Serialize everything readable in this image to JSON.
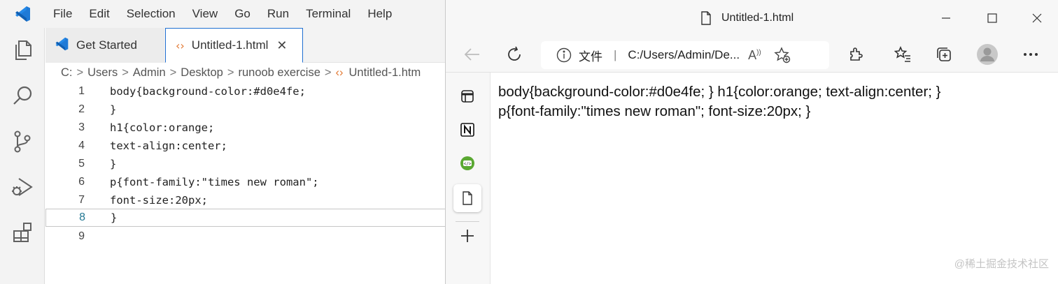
{
  "vscode": {
    "menu": [
      "File",
      "Edit",
      "Selection",
      "View",
      "Go",
      "Run",
      "Terminal",
      "Help"
    ],
    "activity_icons": [
      "explorer-icon",
      "search-icon",
      "source-control-icon",
      "run-debug-icon",
      "extensions-icon"
    ],
    "tabs": [
      {
        "label": "Get Started",
        "active": false
      },
      {
        "label": "Untitled-1.html",
        "active": true
      }
    ],
    "breadcrumb": [
      "C:",
      "Users",
      "Admin",
      "Desktop",
      "runoob exercise",
      "Untitled-1.htm"
    ],
    "code_lines": [
      {
        "num": "1",
        "text": "body{background-color:#d0e4fe;"
      },
      {
        "num": "2",
        "text": "}"
      },
      {
        "num": "3",
        "text": "h1{color:orange;"
      },
      {
        "num": "4",
        "text": "text-align:center;"
      },
      {
        "num": "5",
        "text": "}"
      },
      {
        "num": "6",
        "text": "p{font-family:\"times new roman\";"
      },
      {
        "num": "7",
        "text": "font-size:20px;"
      },
      {
        "num": "8",
        "text": "}"
      },
      {
        "num": "9",
        "text": ""
      }
    ],
    "active_line": "8",
    "colors": {
      "accent": "#1f6fd1",
      "line_number": "#237893"
    }
  },
  "browser": {
    "tab_title": "Untitled-1.html",
    "address": {
      "info_label": "文件",
      "url": "C:/Users/Admin/De..."
    },
    "sidebar_icons": [
      "collections-icon",
      "notion-icon",
      "code-extension-icon",
      "file-icon",
      "add-icon"
    ],
    "content_line1": "body{background-color:#d0e4fe; } h1{color:orange; text-align:center; }",
    "content_line2": "p{font-family:\"times new roman\"; font-size:20px; }",
    "watermark": "@稀土掘金技术社区"
  }
}
